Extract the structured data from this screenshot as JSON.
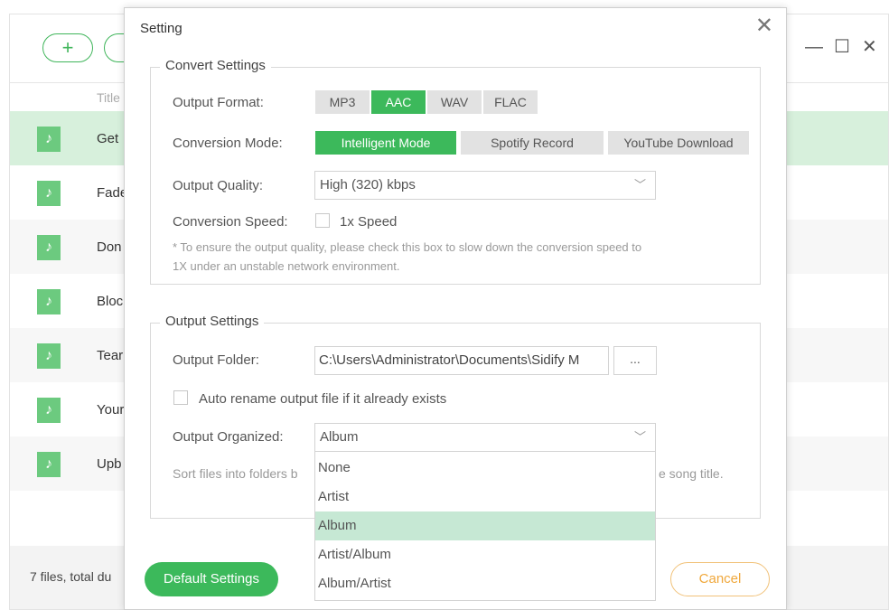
{
  "app": {
    "add_icon": "plus-icon",
    "columns": {
      "title": "Title"
    },
    "rows": [
      {
        "title": "Get"
      },
      {
        "title": "Fade"
      },
      {
        "title": "Don"
      },
      {
        "title": "Bloc"
      },
      {
        "title": "Tear"
      },
      {
        "title": "Your"
      },
      {
        "title": "Upb"
      }
    ],
    "footer_text": "7 files, total du",
    "window_controls": {
      "menu": "≡",
      "minimize": "—",
      "maximize": "☐",
      "close": "✕"
    }
  },
  "dialog": {
    "title": "Setting",
    "close_glyph": "✕",
    "convert_settings": {
      "legend": "Convert Settings",
      "output_format": {
        "label": "Output Format:",
        "options": [
          "MP3",
          "AAC",
          "WAV",
          "FLAC"
        ],
        "selected": "AAC"
      },
      "conversion_mode": {
        "label": "Conversion Mode:",
        "options": [
          "Intelligent Mode",
          "Spotify Record",
          "YouTube Download"
        ],
        "selected": "Intelligent Mode"
      },
      "output_quality": {
        "label": "Output Quality:",
        "value": "High (320) kbps"
      },
      "conversion_speed": {
        "label": "Conversion Speed:",
        "checkbox_label": "1x Speed",
        "checked": false
      },
      "note_line1": "* To ensure the output quality, please check this box to slow down the conversion speed to",
      "note_line2": "1X under an unstable network environment."
    },
    "output_settings": {
      "legend": "Output Settings",
      "output_folder": {
        "label": "Output Folder:",
        "value": "C:\\Users\\Administrator\\Documents\\Sidify M",
        "browse_label": "..."
      },
      "auto_rename": {
        "label": "Auto rename output file if it already exists",
        "checked": false
      },
      "output_organized": {
        "label": "Output Organized:",
        "value": "Album",
        "options": [
          "None",
          "Artist",
          "Album",
          "Artist/Album",
          "Album/Artist"
        ],
        "selected": "Album"
      },
      "hint_left": "Sort files into folders b",
      "hint_right": "e song title."
    },
    "default_button": "Default Settings",
    "cancel_button": "Cancel"
  },
  "colors": {
    "accent_green": "#3cb95b",
    "row_highlight": "#d7f0dc",
    "dropdown_selected": "#c6e8d4",
    "cancel_orange": "#f0a83c"
  }
}
